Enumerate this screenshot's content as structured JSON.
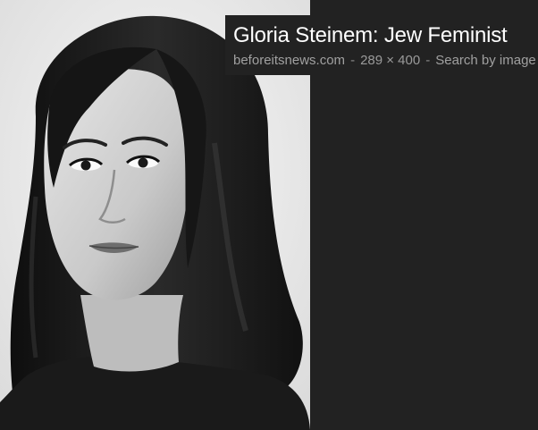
{
  "viewer": {
    "title": "Gloria Steinem:  Jew Feminist",
    "source_domain": "beforeitsnews.com",
    "separator": "-",
    "dimensions": "289 × 400",
    "search_link": "Search by image"
  },
  "colors": {
    "background": "#222222",
    "title_text": "#ffffff",
    "meta_text": "#9a9a9a"
  },
  "photo": {
    "subject": "black-and-white portrait photograph"
  }
}
